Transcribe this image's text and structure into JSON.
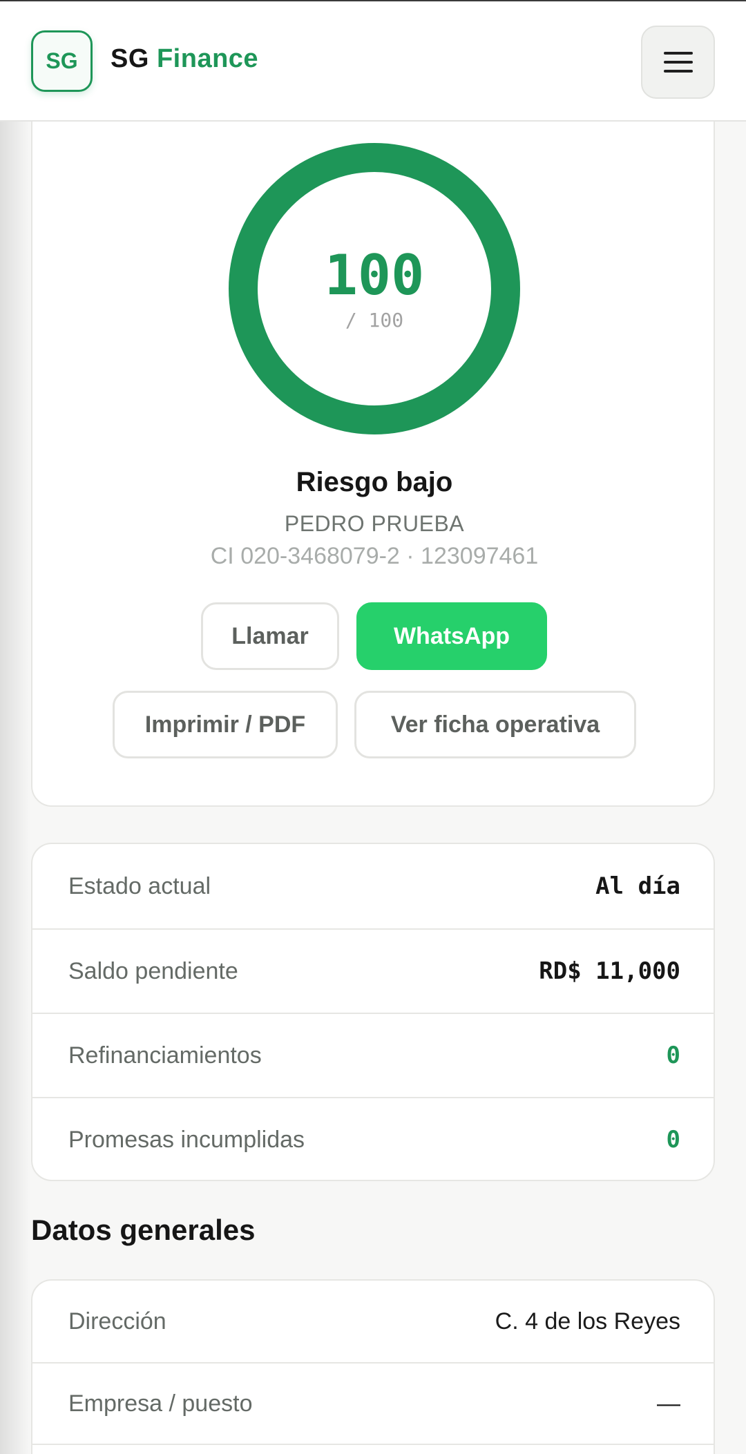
{
  "header": {
    "logo_text": "SG",
    "brand_part1": "SG",
    "brand_part2": "Finance",
    "menu_icon": "hamburger-menu-icon"
  },
  "score": {
    "value": "100",
    "max_label": "/ 100",
    "fraction": 1.0,
    "color": "#1e9658",
    "risk_label": "Riesgo bajo",
    "client_name": "PEDRO PRUEBA",
    "client_id": "CI 020-3468079-2 · 123097461"
  },
  "actions": {
    "call": "Llamar",
    "whatsapp": "WhatsApp",
    "print": "Imprimir / PDF",
    "sheet": "Ver ficha operativa"
  },
  "stats": [
    {
      "label": "Estado actual",
      "value": "Al día"
    },
    {
      "label": "Saldo pendiente",
      "value": "RD$ 11,000"
    },
    {
      "label": "Refinanciamientos",
      "value": "0"
    },
    {
      "label": "Promesas incumplidas",
      "value": "0"
    }
  ],
  "general": {
    "title": "Datos generales",
    "rows": [
      {
        "label": "Dirección",
        "value": "C. 4 de los Reyes"
      },
      {
        "label": "Empresa / puesto",
        "value": "—"
      }
    ]
  },
  "colors": {
    "accent": "#1e9658",
    "whatsapp": "#26d06b"
  }
}
